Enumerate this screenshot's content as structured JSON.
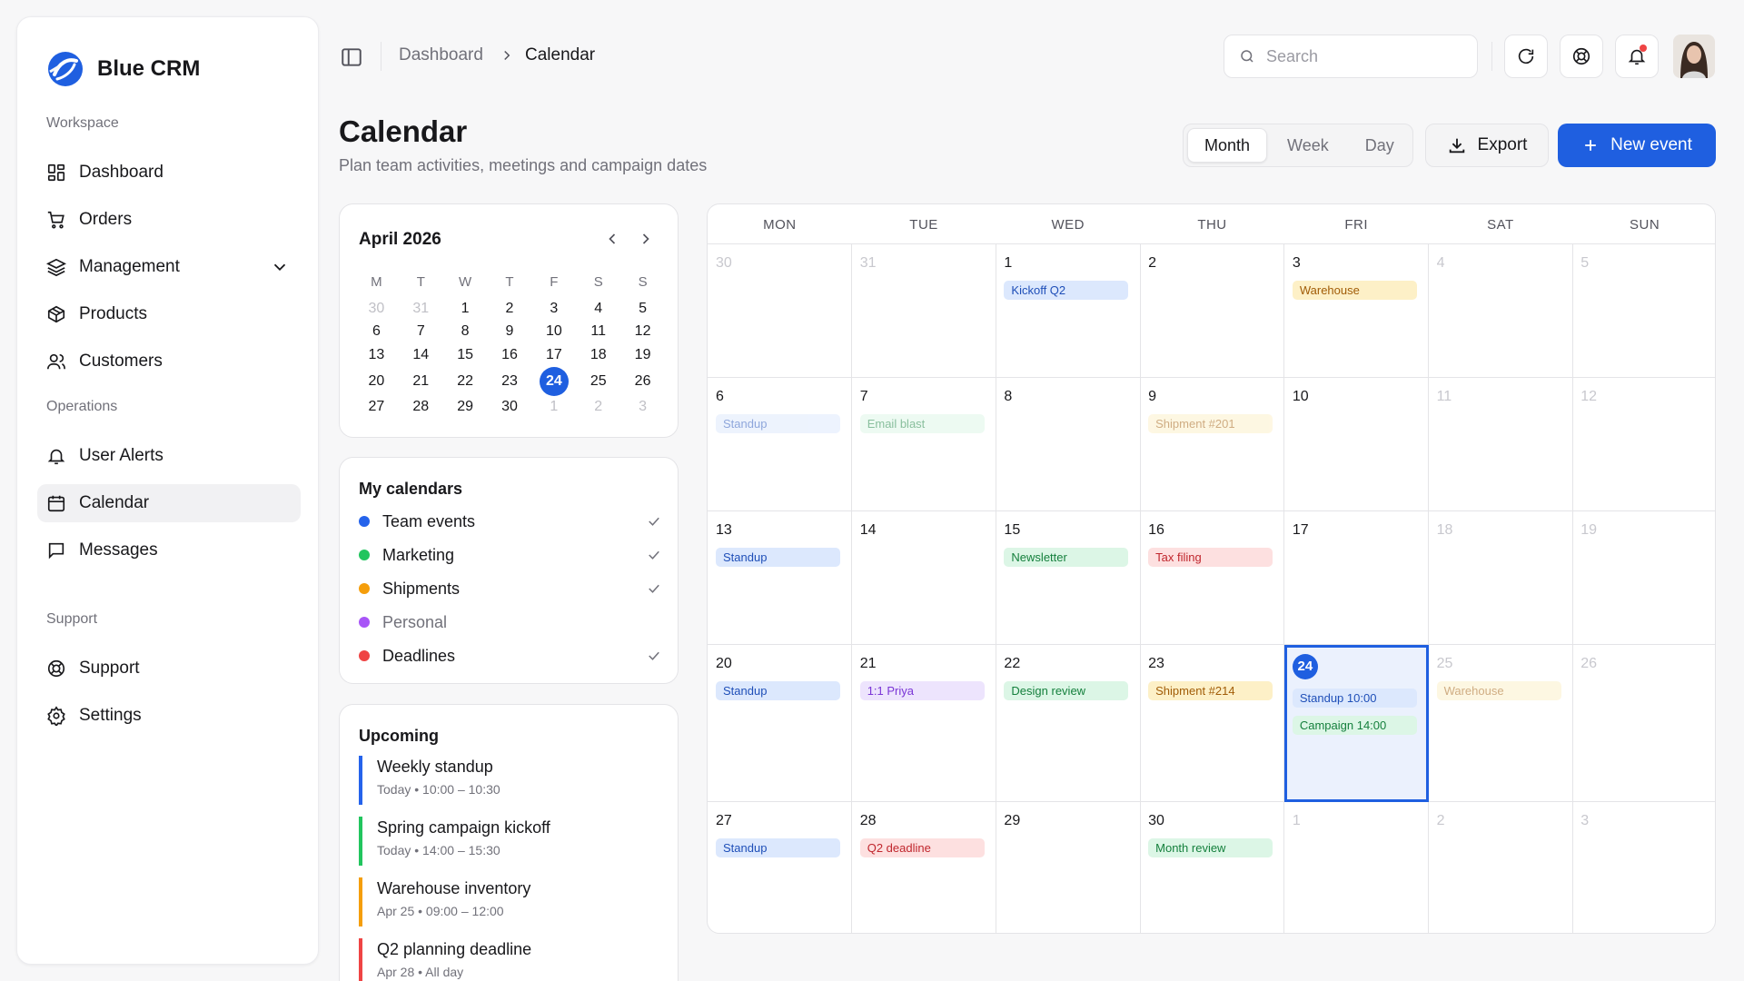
{
  "app": {
    "name": "Blue CRM"
  },
  "sidebar": {
    "sections": {
      "workspace": "Workspace",
      "operations": "Operations",
      "support": "Support"
    },
    "items": {
      "dashboard": "Dashboard",
      "orders": "Orders",
      "management": "Management",
      "products": "Products",
      "customers": "Customers",
      "user_alerts": "User Alerts",
      "calendar": "Calendar",
      "messages": "Messages",
      "support": "Support",
      "settings": "Settings"
    },
    "active": "calendar"
  },
  "header": {
    "breadcrumb": {
      "parent": "Dashboard",
      "current": "Calendar"
    },
    "search_placeholder": "Search"
  },
  "page": {
    "title": "Calendar",
    "subtitle": "Plan team activities, meetings and campaign dates",
    "views": [
      "Month",
      "Week",
      "Day"
    ],
    "active_view": "Month",
    "export_label": "Export",
    "new_event_label": "New event"
  },
  "colors": {
    "accent": "#1f5fe0",
    "team": "#2563eb",
    "marketing": "#22c55e",
    "shipments": "#f59e0b",
    "personal": "#a855f7",
    "deadlines": "#ef4444"
  },
  "mini_calendar": {
    "title": "April 2026",
    "weekdays": [
      "M",
      "T",
      "W",
      "T",
      "F",
      "S",
      "S"
    ],
    "weeks": [
      [
        "30",
        "31",
        "1",
        "2",
        "3",
        "4",
        "5"
      ],
      [
        "6",
        "7",
        "8",
        "9",
        "10",
        "11",
        "12"
      ],
      [
        "13",
        "14",
        "15",
        "16",
        "17",
        "18",
        "19"
      ],
      [
        "20",
        "21",
        "22",
        "23",
        "24",
        "25",
        "26"
      ],
      [
        "27",
        "28",
        "29",
        "30",
        "1",
        "2",
        "3"
      ]
    ],
    "today": "24"
  },
  "my_calendars": {
    "title": "My calendars",
    "items": [
      {
        "label": "Team events",
        "checked": true
      },
      {
        "label": "Marketing",
        "checked": true
      },
      {
        "label": "Shipments",
        "checked": true
      },
      {
        "label": "Personal",
        "checked": false
      },
      {
        "label": "Deadlines",
        "checked": true
      }
    ]
  },
  "upcoming": {
    "title": "Upcoming",
    "items": [
      {
        "title": "Weekly standup",
        "meta": "Today • 10:00 – 10:30"
      },
      {
        "title": "Spring campaign kickoff",
        "meta": "Today • 14:00 – 15:30"
      },
      {
        "title": "Warehouse inventory",
        "meta": "Apr 25 • 09:00 – 12:00"
      },
      {
        "title": "Q2 planning deadline",
        "meta": "Apr 28 • All day"
      }
    ]
  },
  "month": {
    "weekdays": [
      "MON",
      "TUE",
      "WED",
      "THU",
      "FRI",
      "SAT",
      "SUN"
    ],
    "weeks": [
      [
        {
          "day": "30",
          "events": []
        },
        {
          "day": "31",
          "events": []
        },
        {
          "day": "1",
          "events": [
            {
              "label": "Kickoff Q2",
              "color": "blue"
            }
          ]
        },
        {
          "day": "2",
          "events": []
        },
        {
          "day": "3",
          "events": [
            {
              "label": "Warehouse",
              "color": "amber"
            }
          ]
        },
        {
          "day": "4",
          "events": []
        },
        {
          "day": "5",
          "events": []
        }
      ],
      [
        {
          "day": "6",
          "events": [
            {
              "label": "Standup",
              "color": "blue"
            }
          ]
        },
        {
          "day": "7",
          "events": [
            {
              "label": "Email blast",
              "color": "green"
            }
          ]
        },
        {
          "day": "8",
          "events": []
        },
        {
          "day": "9",
          "events": [
            {
              "label": "Shipment #201",
              "color": "amber"
            }
          ]
        },
        {
          "day": "10",
          "events": []
        },
        {
          "day": "11",
          "events": []
        },
        {
          "day": "12",
          "events": []
        }
      ],
      [
        {
          "day": "13",
          "events": [
            {
              "label": "Standup",
              "color": "blue"
            }
          ]
        },
        {
          "day": "14",
          "events": []
        },
        {
          "day": "15",
          "events": [
            {
              "label": "Newsletter",
              "color": "green"
            }
          ]
        },
        {
          "day": "16",
          "events": [
            {
              "label": "Tax filing",
              "color": "red"
            }
          ]
        },
        {
          "day": "17",
          "events": []
        },
        {
          "day": "18",
          "events": []
        },
        {
          "day": "19",
          "events": []
        }
      ],
      [
        {
          "day": "20",
          "events": [
            {
              "label": "Standup",
              "color": "blue"
            }
          ]
        },
        {
          "day": "21",
          "events": [
            {
              "label": "1:1 Priya",
              "color": "purple"
            }
          ]
        },
        {
          "day": "22",
          "events": [
            {
              "label": "Design review",
              "color": "green"
            }
          ]
        },
        {
          "day": "23",
          "events": [
            {
              "label": "Shipment #214",
              "color": "amber"
            }
          ]
        },
        {
          "day": "24",
          "events": [
            {
              "label": "Standup 10:00",
              "color": "blue"
            },
            {
              "label": "Campaign 14:00",
              "color": "green"
            }
          ]
        },
        {
          "day": "25",
          "events": [
            {
              "label": "Warehouse",
              "color": "amber"
            }
          ]
        },
        {
          "day": "26",
          "events": []
        }
      ],
      [
        {
          "day": "27",
          "events": [
            {
              "label": "Standup",
              "color": "blue"
            }
          ]
        },
        {
          "day": "28",
          "events": [
            {
              "label": "Q2 deadline",
              "color": "red"
            }
          ]
        },
        {
          "day": "29",
          "events": []
        },
        {
          "day": "30",
          "events": [
            {
              "label": "Month review",
              "color": "green"
            }
          ]
        },
        {
          "day": "1",
          "events": []
        },
        {
          "day": "2",
          "events": []
        },
        {
          "day": "3",
          "events": []
        }
      ]
    ]
  }
}
